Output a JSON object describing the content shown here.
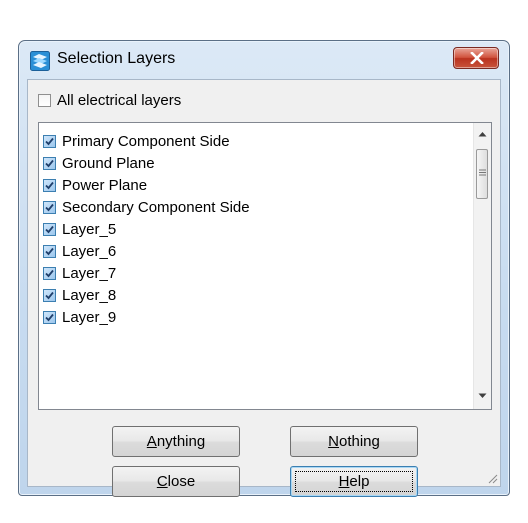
{
  "window": {
    "title": "Selection Layers",
    "app_icon": "selection-layers-icon",
    "close_icon": "close-icon"
  },
  "all_layers": {
    "label": "All electrical layers",
    "checked": false
  },
  "layers": [
    {
      "label": "Primary Component Side",
      "checked": true
    },
    {
      "label": "Ground Plane",
      "checked": true
    },
    {
      "label": "Power Plane",
      "checked": true
    },
    {
      "label": "Secondary Component Side",
      "checked": true
    },
    {
      "label": "Layer_5",
      "checked": true
    },
    {
      "label": "Layer_6",
      "checked": true
    },
    {
      "label": "Layer_7",
      "checked": true
    },
    {
      "label": "Layer_8",
      "checked": true
    },
    {
      "label": "Layer_9",
      "checked": true
    }
  ],
  "buttons": {
    "anything": {
      "mnemonic": "A",
      "rest": "nything"
    },
    "nothing": {
      "mnemonic": "N",
      "rest": "othing"
    },
    "close": {
      "mnemonic": "C",
      "rest": "lose"
    },
    "help": {
      "mnemonic": "H",
      "rest": "elp"
    }
  },
  "colors": {
    "check_accent": "#3c7fb1",
    "close_button": "#c8543c",
    "frame": "#c7dbf0"
  }
}
